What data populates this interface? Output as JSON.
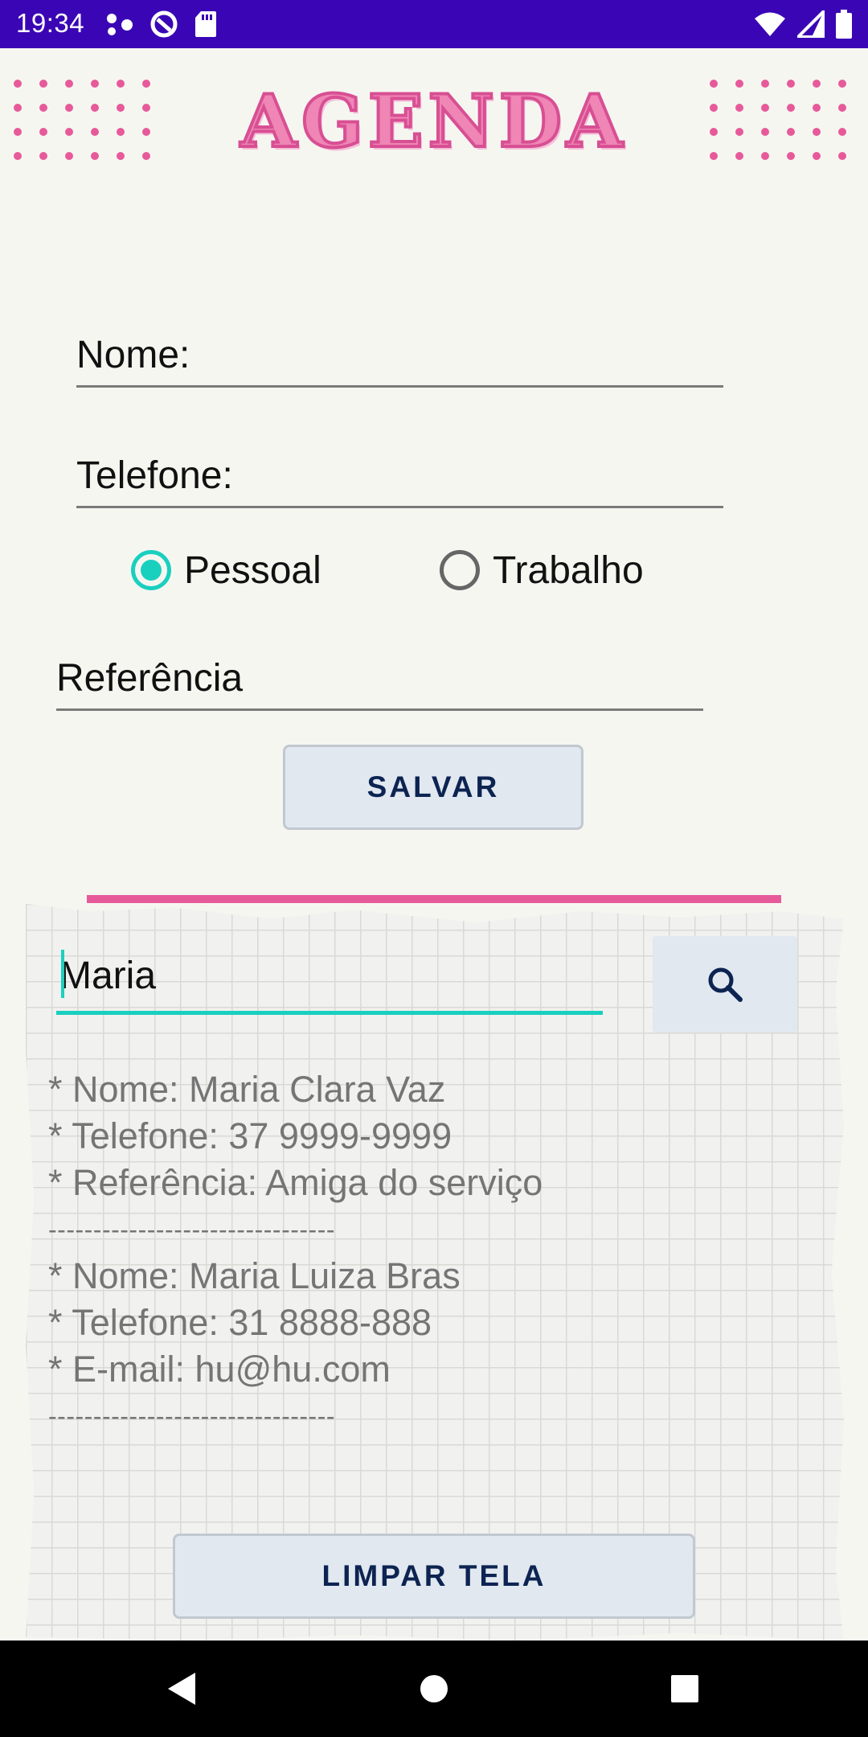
{
  "status_bar": {
    "time": "19:34",
    "left_icons": [
      "notification-dots-icon",
      "data-saver-icon",
      "sd-card-icon"
    ],
    "right_icons": [
      "wifi-icon",
      "signal-icon",
      "battery-icon"
    ],
    "color": "#3a06b5"
  },
  "header": {
    "title": "AGENDA",
    "accent_color": "#e75a9a"
  },
  "form": {
    "nome_label": "Nome:",
    "telefone_label": "Telefone:",
    "radio_options": [
      {
        "label": "Pessoal",
        "checked": true
      },
      {
        "label": "Trabalho",
        "checked": false
      }
    ],
    "referencia_label": "Referência",
    "save_label": "SALVAR"
  },
  "search": {
    "value": "Maria",
    "button_icon": "search-icon",
    "accent_color": "#19d0bf"
  },
  "results": {
    "lines": [
      "* Nome: Maria Clara Vaz",
      "* Telefone: 37 9999-9999",
      "* Referência: Amiga do serviço",
      "--------------------------------",
      "* Nome: Maria Luiza Bras",
      "* Telefone: 31 8888-888",
      "* E-mail: hu@hu.com",
      "--------------------------------"
    ]
  },
  "footer": {
    "clear_label": "LIMPAR TELA"
  },
  "nav_bar": {
    "icons": [
      "back-icon",
      "home-icon",
      "recents-icon"
    ]
  }
}
